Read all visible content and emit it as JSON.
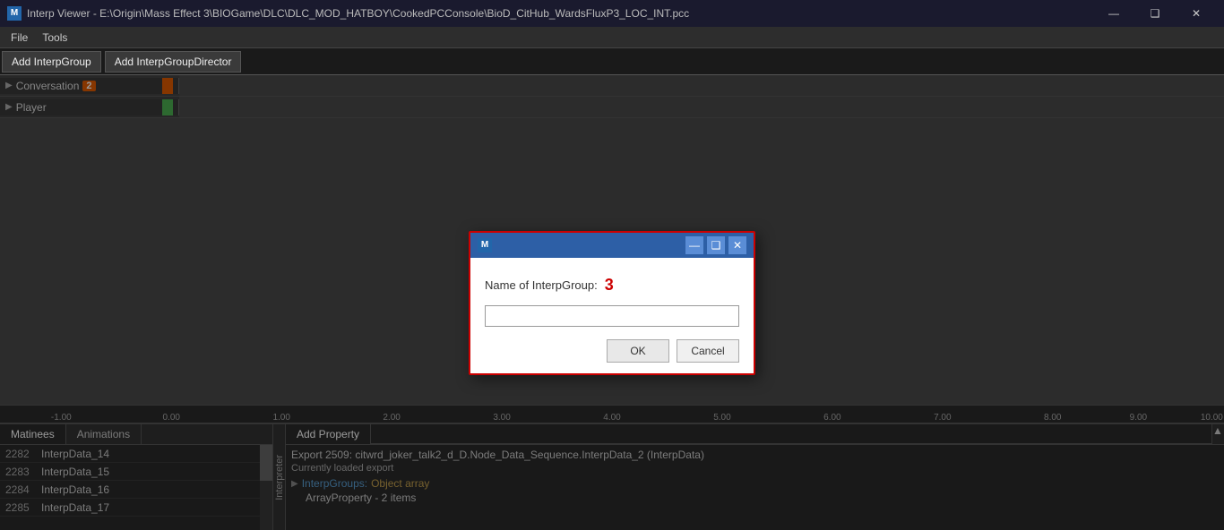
{
  "titlebar": {
    "icon_label": "M",
    "title": "Interp Viewer - E:\\Origin\\Mass Effect 3\\BIOGame\\DLC\\DLC_MOD_HATBOY\\CookedPCConsole\\BioD_CitHub_WardsFluxP3_LOC_INT.pcc",
    "minimize": "—",
    "maximize": "❑",
    "close": "✕"
  },
  "menubar": {
    "items": [
      "File",
      "Tools"
    ]
  },
  "toolbar": {
    "add_interp_group": "Add InterpGroup",
    "add_interp_group_director": "Add InterpGroupDirector"
  },
  "tracks": [
    {
      "label": "Conversation",
      "badge": "2",
      "color": "#e05a00",
      "has_arrow": true
    },
    {
      "label": "Player",
      "badge": "",
      "color": "#4caf50",
      "has_arrow": true
    }
  ],
  "ruler": {
    "ticks": [
      "-1.00",
      "0.00",
      "1.00",
      "2.00",
      "3.00",
      "4.00",
      "5.00",
      "6.00",
      "7.00",
      "8.00",
      "9.00",
      "10.00"
    ]
  },
  "bottom_panel": {
    "tabs": [
      "Matinees",
      "Animations"
    ],
    "active_tab": "Matinees",
    "list_items": [
      {
        "num": "2282",
        "label": "InterpData_14"
      },
      {
        "num": "2283",
        "label": "InterpData_15"
      },
      {
        "num": "2284",
        "label": "InterpData_16"
      },
      {
        "num": "2285",
        "label": "InterpData_17"
      }
    ]
  },
  "interpreter_label": "Interpreter",
  "properties_panel": {
    "tab": "Add Property",
    "export_line": "Export 2509: citwrd_joker_talk2_d_D.Node_Data_Sequence.InterpData_2 (InterpData)",
    "loaded_export": "Currently loaded export",
    "interp_groups_key": "InterpGroups:",
    "interp_groups_type": "Object array",
    "array_property": "ArrayProperty - 2 items"
  },
  "modal": {
    "icon_label": "M",
    "title": "",
    "label": "Name of InterpGroup:",
    "badge": "3",
    "input_value": "",
    "ok_label": "OK",
    "cancel_label": "Cancel"
  }
}
